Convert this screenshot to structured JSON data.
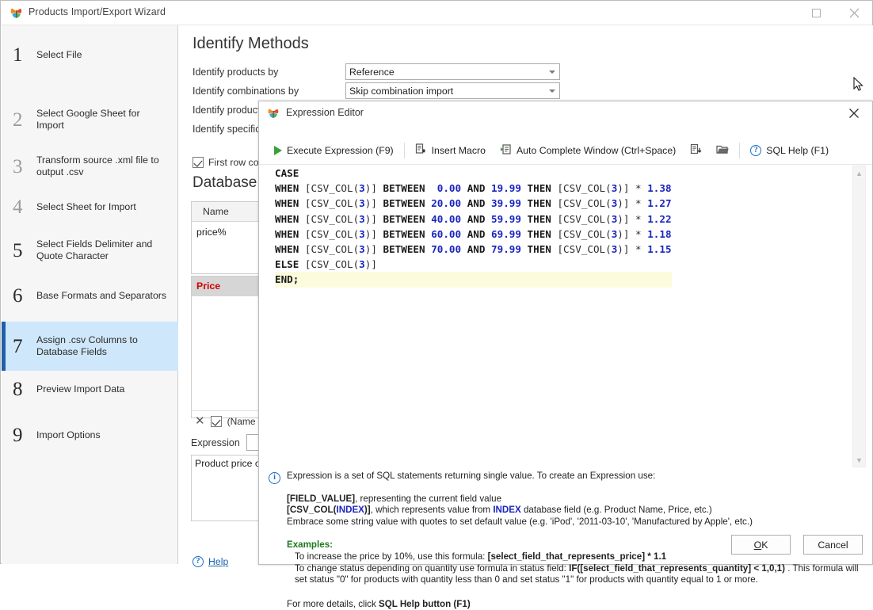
{
  "window": {
    "title": "Products Import/Export Wizard",
    "icon": "app-butterfly-icon",
    "maximize_label": "",
    "close_label": "✕"
  },
  "sidebar": {
    "steps": [
      {
        "num": "1",
        "label": "Select File",
        "state": "done"
      },
      {
        "num": "2",
        "label": "Select Google Sheet for Import",
        "state": "idle"
      },
      {
        "num": "3",
        "label": "Transform source .xml file to output .csv",
        "state": "idle"
      },
      {
        "num": "4",
        "label": "Select Sheet for Import",
        "state": "idle"
      },
      {
        "num": "5",
        "label": "Select Fields Delimiter and Quote Character",
        "state": "done"
      },
      {
        "num": "6",
        "label": "Base Formats and Separators",
        "state": "done"
      },
      {
        "num": "7",
        "label": "Assign .csv Columns to Database Fields",
        "state": "active"
      },
      {
        "num": "8",
        "label": "Preview Import Data",
        "state": "done"
      },
      {
        "num": "9",
        "label": "Import Options",
        "state": "done"
      }
    ]
  },
  "main": {
    "page_title": "Identify Methods",
    "fields": [
      {
        "label": "Identify products by",
        "value": "Reference"
      },
      {
        "label": "Identify combinations by",
        "value": "Skip combination import"
      },
      {
        "label": "Identify product",
        "value": ""
      },
      {
        "label": "Identify specific",
        "value": ""
      }
    ],
    "first_row_checkbox": {
      "label": "First row con",
      "checked": true
    },
    "db_fields_title": "Database F",
    "grid_top": {
      "header": "Name",
      "cell": "price%"
    },
    "grid_bottom": {
      "row": "Price"
    },
    "grid_footer": {
      "x": "✕",
      "checked": true,
      "label": "(Name"
    },
    "expression_row": {
      "label": "Expression",
      "value": ""
    },
    "description": "Product price or",
    "help_link": {
      "label": "Help",
      "icon": "question-circle-icon"
    }
  },
  "dialog": {
    "title": "Expression Editor",
    "icon": "app-butterfly-icon",
    "close_label": "✕",
    "toolbar": [
      {
        "name": "execute-expression",
        "label": "Execute Expression (F9)",
        "icon": "play-icon"
      },
      {
        "name": "insert-macro",
        "label": "Insert Macro",
        "icon": "insert-macro-icon"
      },
      {
        "name": "auto-complete-window",
        "label": "Auto Complete Window (Ctrl+Space)",
        "icon": "auto-complete-icon"
      },
      {
        "name": "save-expression",
        "label": "",
        "icon": "save-export-icon"
      },
      {
        "name": "open-expression",
        "label": "",
        "icon": "folder-open-icon"
      },
      {
        "name": "sql-help",
        "label": "SQL Help (F1)",
        "icon": "question-circle-icon"
      }
    ],
    "code_lines": [
      [
        {
          "t": "CASE",
          "c": "k"
        }
      ],
      [
        {
          "t": "WHEN ",
          "c": "k"
        },
        {
          "t": "[CSV_COL(",
          "c": "id"
        },
        {
          "t": "3",
          "c": "num"
        },
        {
          "t": ")] ",
          "c": "id"
        },
        {
          "t": "BETWEEN ",
          "c": "k"
        },
        {
          "t": " 0.00",
          "c": "num"
        },
        {
          "t": " AND ",
          "c": "k"
        },
        {
          "t": "19.99",
          "c": "num"
        },
        {
          "t": " THEN ",
          "c": "k"
        },
        {
          "t": "[CSV_COL(",
          "c": "id"
        },
        {
          "t": "3",
          "c": "num"
        },
        {
          "t": ")] ",
          "c": "id"
        },
        {
          "t": "* ",
          "c": "op"
        },
        {
          "t": "1.38",
          "c": "num"
        }
      ],
      [
        {
          "t": "WHEN ",
          "c": "k"
        },
        {
          "t": "[CSV_COL(",
          "c": "id"
        },
        {
          "t": "3",
          "c": "num"
        },
        {
          "t": ")] ",
          "c": "id"
        },
        {
          "t": "BETWEEN ",
          "c": "k"
        },
        {
          "t": "20.00",
          "c": "num"
        },
        {
          "t": " AND ",
          "c": "k"
        },
        {
          "t": "39.99",
          "c": "num"
        },
        {
          "t": " THEN ",
          "c": "k"
        },
        {
          "t": "[CSV_COL(",
          "c": "id"
        },
        {
          "t": "3",
          "c": "num"
        },
        {
          "t": ")] ",
          "c": "id"
        },
        {
          "t": "* ",
          "c": "op"
        },
        {
          "t": "1.27",
          "c": "num"
        }
      ],
      [
        {
          "t": "WHEN ",
          "c": "k"
        },
        {
          "t": "[CSV_COL(",
          "c": "id"
        },
        {
          "t": "3",
          "c": "num"
        },
        {
          "t": ")] ",
          "c": "id"
        },
        {
          "t": "BETWEEN ",
          "c": "k"
        },
        {
          "t": "40.00",
          "c": "num"
        },
        {
          "t": " AND ",
          "c": "k"
        },
        {
          "t": "59.99",
          "c": "num"
        },
        {
          "t": " THEN ",
          "c": "k"
        },
        {
          "t": "[CSV_COL(",
          "c": "id"
        },
        {
          "t": "3",
          "c": "num"
        },
        {
          "t": ")] ",
          "c": "id"
        },
        {
          "t": "* ",
          "c": "op"
        },
        {
          "t": "1.22",
          "c": "num"
        }
      ],
      [
        {
          "t": "WHEN ",
          "c": "k"
        },
        {
          "t": "[CSV_COL(",
          "c": "id"
        },
        {
          "t": "3",
          "c": "num"
        },
        {
          "t": ")] ",
          "c": "id"
        },
        {
          "t": "BETWEEN ",
          "c": "k"
        },
        {
          "t": "60.00",
          "c": "num"
        },
        {
          "t": " AND ",
          "c": "k"
        },
        {
          "t": "69.99",
          "c": "num"
        },
        {
          "t": " THEN ",
          "c": "k"
        },
        {
          "t": "[CSV_COL(",
          "c": "id"
        },
        {
          "t": "3",
          "c": "num"
        },
        {
          "t": ")] ",
          "c": "id"
        },
        {
          "t": "* ",
          "c": "op"
        },
        {
          "t": "1.18",
          "c": "num"
        }
      ],
      [
        {
          "t": "WHEN ",
          "c": "k"
        },
        {
          "t": "[CSV_COL(",
          "c": "id"
        },
        {
          "t": "3",
          "c": "num"
        },
        {
          "t": ")] ",
          "c": "id"
        },
        {
          "t": "BETWEEN ",
          "c": "k"
        },
        {
          "t": "70.00",
          "c": "num"
        },
        {
          "t": " AND ",
          "c": "k"
        },
        {
          "t": "79.99",
          "c": "num"
        },
        {
          "t": " THEN ",
          "c": "k"
        },
        {
          "t": "[CSV_COL(",
          "c": "id"
        },
        {
          "t": "3",
          "c": "num"
        },
        {
          "t": ")] ",
          "c": "id"
        },
        {
          "t": "* ",
          "c": "op"
        },
        {
          "t": "1.15",
          "c": "num"
        }
      ],
      [
        {
          "t": "ELSE ",
          "c": "k"
        },
        {
          "t": "[CSV_COL(",
          "c": "id"
        },
        {
          "t": "3",
          "c": "num"
        },
        {
          "t": ")]",
          "c": "id"
        }
      ],
      [
        {
          "t": "END;",
          "c": "k"
        }
      ]
    ],
    "current_line_index": 7,
    "code_plain": "CASE\nWHEN [CSV_COL(3)] BETWEEN  0.00 AND 19.99 THEN [CSV_COL(3)] * 1.38\nWHEN [CSV_COL(3)] BETWEEN 20.00 AND 39.99 THEN [CSV_COL(3)] * 1.27\nWHEN [CSV_COL(3)] BETWEEN 40.00 AND 59.99 THEN [CSV_COL(3)] * 1.22\nWHEN [CSV_COL(3)] BETWEEN 60.00 AND 69.99 THEN [CSV_COL(3)] * 1.18\nWHEN [CSV_COL(3)] BETWEEN 70.00 AND 79.99 THEN [CSV_COL(3)] * 1.15\nELSE [CSV_COL(3)]\nEND;",
    "info": {
      "head": "Expression is a set of SQL statements returning single value. To create an Expression use:",
      "line1_bold": "[FIELD_VALUE]",
      "line1_rest": ", representing the current field value",
      "line2_a": "[CSV_COL(",
      "line2_index": "INDEX",
      "line2_b": ")]",
      "line2_c": ", which represents value from ",
      "line2_index2": "INDEX",
      "line2_d": " database field (e.g. Product Name, Price, etc.)",
      "line3": "Embrace some string value with quotes to set default value (e.g. 'iPod', '2011-03-10', 'Manufactured by Apple', etc.)",
      "examples_title": "Examples:",
      "ex1_pre": "To increase the price by 10%, use this formula: ",
      "ex1_bold": "[select_field_that_represents_price] * 1.1",
      "ex2_pre": "To change status depending on quantity use formula in status field: ",
      "ex2_bold": "IF([select_field_that_represents_quantity] < 1,0,1)",
      "ex2_post": " . This formula will set status \"0\" for products with quantity less than 0 and set status \"1\" for products with quantity equal to 1 or more.",
      "foot_pre": "For more details, click ",
      "foot_bold": "SQL Help button (F1)"
    },
    "buttons": {
      "ok": "OK",
      "ok_accel": "O",
      "ok_rest": "K",
      "cancel": "Cancel"
    },
    "scrollbar": {
      "up": "▲",
      "down": "▼"
    }
  },
  "colors": {
    "accent": "#1e5fa8",
    "active_step_bg": "#cfe7fa",
    "link": "#1b5fad",
    "error": "#d40000",
    "keyword": "#1a1a1a",
    "number": "#1a24c0",
    "current_line": "#fcfbdd",
    "green": "#1b7a1b"
  }
}
